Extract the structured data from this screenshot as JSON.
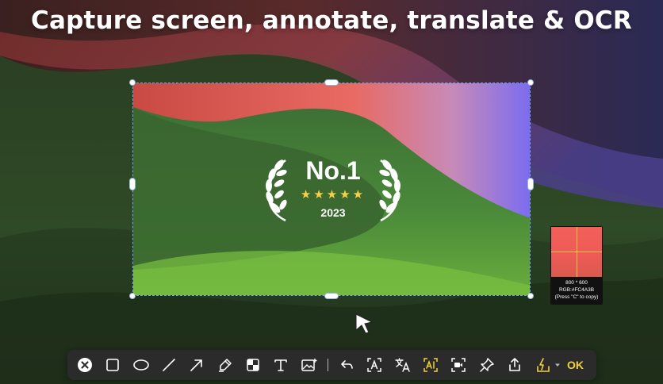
{
  "headline": "Capture screen, annotate, translate & OCR",
  "award": {
    "title": "No.1",
    "stars": "★★★★★",
    "year": "2023"
  },
  "magnifier": {
    "size": "800 * 600",
    "color": "RGB:#FC4A3B",
    "hint": "(Press \"C\" to copy)"
  },
  "toolbar": {
    "tools": [
      {
        "icon": "close-icon"
      },
      {
        "icon": "rectangle-icon"
      },
      {
        "icon": "ellipse-icon"
      },
      {
        "icon": "line-icon"
      },
      {
        "icon": "arrow-icon"
      },
      {
        "icon": "highlighter-icon"
      },
      {
        "icon": "mosaic-icon"
      },
      {
        "icon": "text-icon"
      },
      {
        "icon": "image-icon"
      },
      {
        "icon": "undo-icon"
      },
      {
        "icon": "ocr-icon"
      },
      {
        "icon": "translate-icon"
      },
      {
        "icon": "ai-ocr-icon"
      },
      {
        "icon": "record-icon"
      },
      {
        "icon": "pin-icon"
      },
      {
        "icon": "share-icon"
      },
      {
        "icon": "save-icon"
      },
      {
        "icon": "dropdown-icon"
      }
    ],
    "ok_label": "OK"
  },
  "colors": {
    "accent": "#F2D33A",
    "selection_border": "#6FA3FF",
    "toolbar_bg": "#2B2B2B"
  }
}
